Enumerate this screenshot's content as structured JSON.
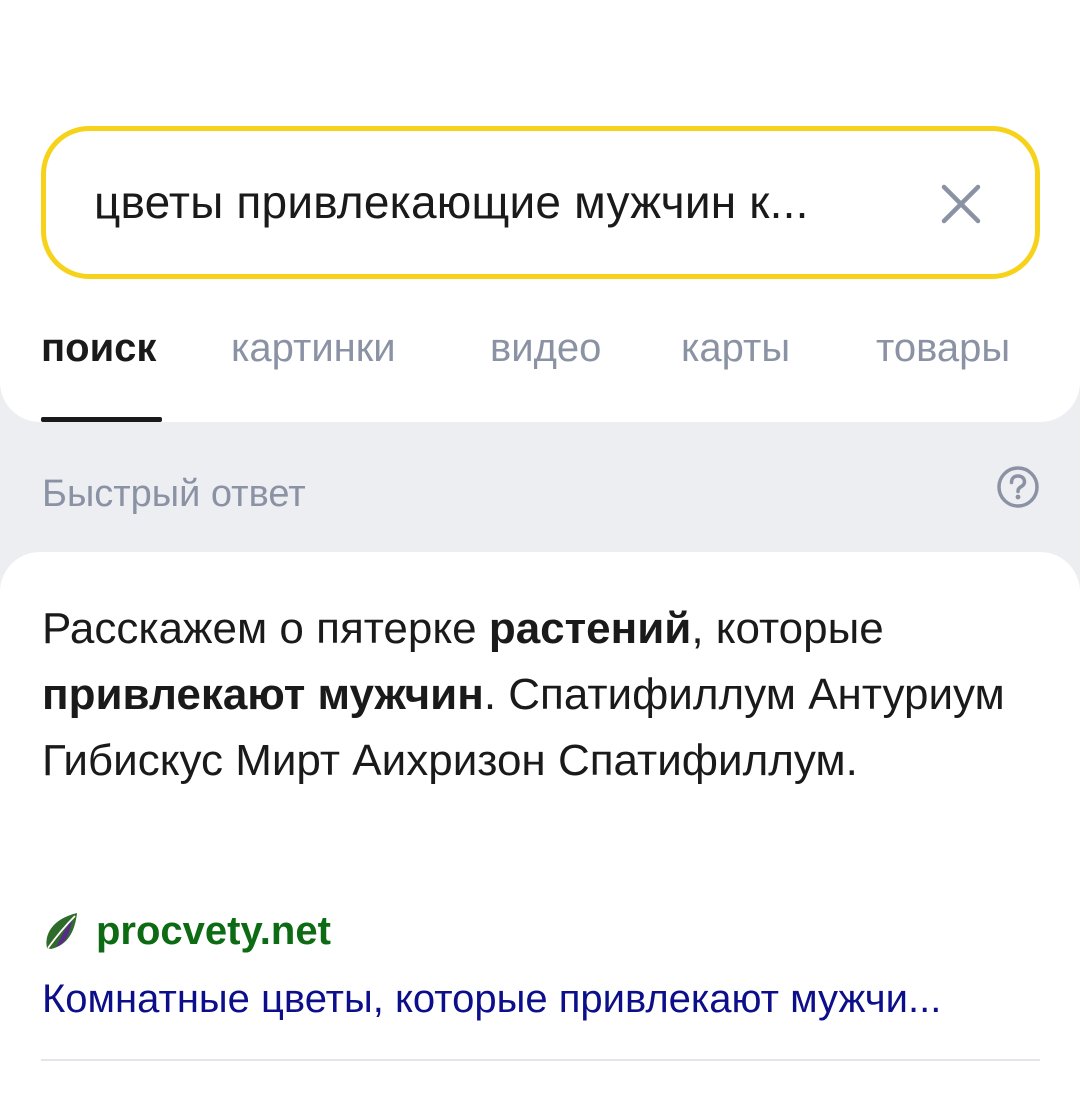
{
  "search": {
    "query": "цветы привлекающие мужчин к...",
    "clear_icon": "close-icon"
  },
  "tabs": [
    {
      "label": "поиск",
      "active": true
    },
    {
      "label": "картинки",
      "active": false
    },
    {
      "label": "видео",
      "active": false
    },
    {
      "label": "карты",
      "active": false
    },
    {
      "label": "товары",
      "active": false
    }
  ],
  "quick_answer": {
    "title": "Быстрый ответ",
    "help_icon": "question-circle-icon",
    "text_parts": [
      {
        "text": "Расскажем о пятерке ",
        "bold": false
      },
      {
        "text": "растений",
        "bold": true
      },
      {
        "text": ", которые ",
        "bold": false
      },
      {
        "text": "привлекают мужчин",
        "bold": true
      },
      {
        "text": ". Спатифиллум Антуриум Гибискус Мирт Аихризон Спатифиллум.",
        "bold": false
      }
    ],
    "source": {
      "favicon": "leaf-icon",
      "domain": "procvety.net",
      "link_text": "Комнатные цветы, которые привлекают мужчи..."
    }
  },
  "colors": {
    "accent_yellow": "#f7d21a",
    "tab_inactive": "#8a92a4",
    "domain_green": "#0d6b13",
    "link_blue": "#0c0e8a",
    "background": "#eceef2"
  }
}
